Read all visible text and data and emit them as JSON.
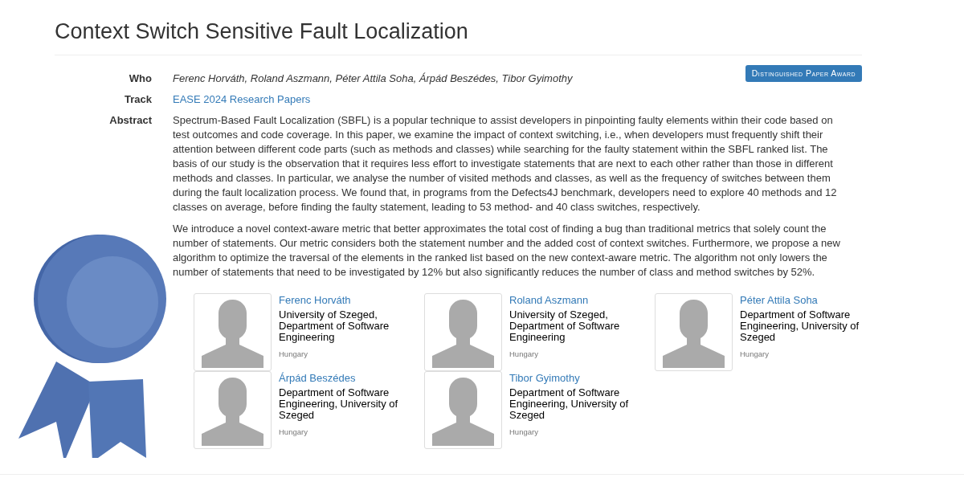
{
  "title": "Context Switch Sensitive Fault Localization",
  "award_badge": "Distinguished Paper Award",
  "fields": [
    {
      "kind": "text",
      "label": "Who",
      "value": "Ferenc Horváth, Roland Aszmann, Péter Attila Soha, Árpád Beszédes, Tibor Gyimothy"
    },
    {
      "kind": "link",
      "label": "Track",
      "value": "EASE 2024 Research Papers"
    },
    {
      "kind": "paragraphs",
      "label": "Abstract",
      "paragraphs": [
        "Spectrum-Based Fault Localization (SBFL) is a popular technique to assist developers in pinpointing faulty elements within their code based on test outcomes and code coverage. In this paper, we examine the impact of context switching, i.e., when developers must frequently shift their attention between different code parts (such as methods and classes) while searching for the faulty statement within the SBFL ranked list. The basis of our study is the observation that it requires less effort to investigate statements that are next to each other rather than those in different methods and classes. In particular, we analyse the number of visited methods and classes, as well as the frequency of switches between them during the fault localization process. We found that, in programs from the Defects4J benchmark, developers need to explore 40 methods and 12 classes on average, before finding the faulty statement, leading to 53 method- and 40 class switches, respectively.",
        "We introduce a novel context-aware metric that better approximates the total cost of finding a bug than traditional metrics that solely count the number of statements. Our metric considers both the statement number and the added cost of context switches. Furthermore, we propose a new algorithm to optimize the traversal of the elements in the ranked list based on the new context-aware metric. The algorithm not only lowers the number of statements that need to be investigated by 12% but also significantly reduces the number of class and method switches by 52%."
      ]
    }
  ],
  "authors": [
    {
      "name": "Ferenc Horváth",
      "affiliation": "University of Szeged, Department of Software Engineering",
      "country": "Hungary"
    },
    {
      "name": "Roland Aszmann",
      "affiliation": "University of Szeged, Department of Software Engineering",
      "country": "Hungary"
    },
    {
      "name": "Péter Attila Soha",
      "affiliation": "Department of Software Engineering, University of Szeged",
      "country": "Hungary"
    },
    {
      "name": "Árpád Beszédes",
      "affiliation": "Department of Software Engineering, University of Szeged",
      "country": "Hungary"
    },
    {
      "name": "Tibor Gyimothy",
      "affiliation": "Department of Software Engineering, University of Szeged",
      "country": "Hungary"
    }
  ]
}
